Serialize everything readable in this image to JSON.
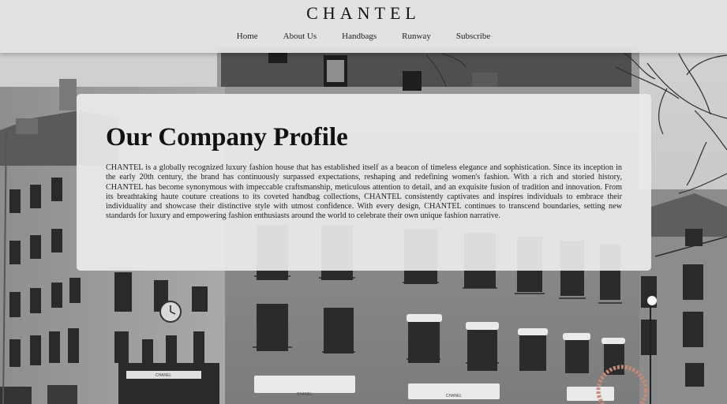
{
  "header": {
    "brand": "CHANTEL",
    "nav": [
      {
        "label": "Home"
      },
      {
        "label": "About Us"
      },
      {
        "label": "Handbags"
      },
      {
        "label": "Runway"
      },
      {
        "label": "Subscribe"
      }
    ]
  },
  "profile": {
    "heading": "Our Company Profile",
    "body": "CHANTEL is a globally recognized luxury fashion house that has established itself as a beacon of timeless elegance and sophistication. Since its inception in the early 20th century, the brand has continuously surpassed expectations, reshaping and redefining women's fashion. With a rich and storied history, CHANTEL has become synonymous with impeccable craftsmanship, meticulous attention to detail, and an exquisite fusion of tradition and innovation. From its breathtaking haute couture creations to its coveted handbag collections, CHANTEL consistently captivates and inspires individuals to embrace their individuality and showcase their distinctive style with utmost confidence. With every design, CHANTEL continues to transcend boundaries, setting new standards for luxury and empowering fashion enthusiasts around the world to celebrate their own unique fashion narrative."
  },
  "background": {
    "storefront_sign": "CHANEL"
  },
  "colors": {
    "header_bg": "#e2e2e2",
    "card_bg": "#ececee",
    "text": "#111111"
  }
}
